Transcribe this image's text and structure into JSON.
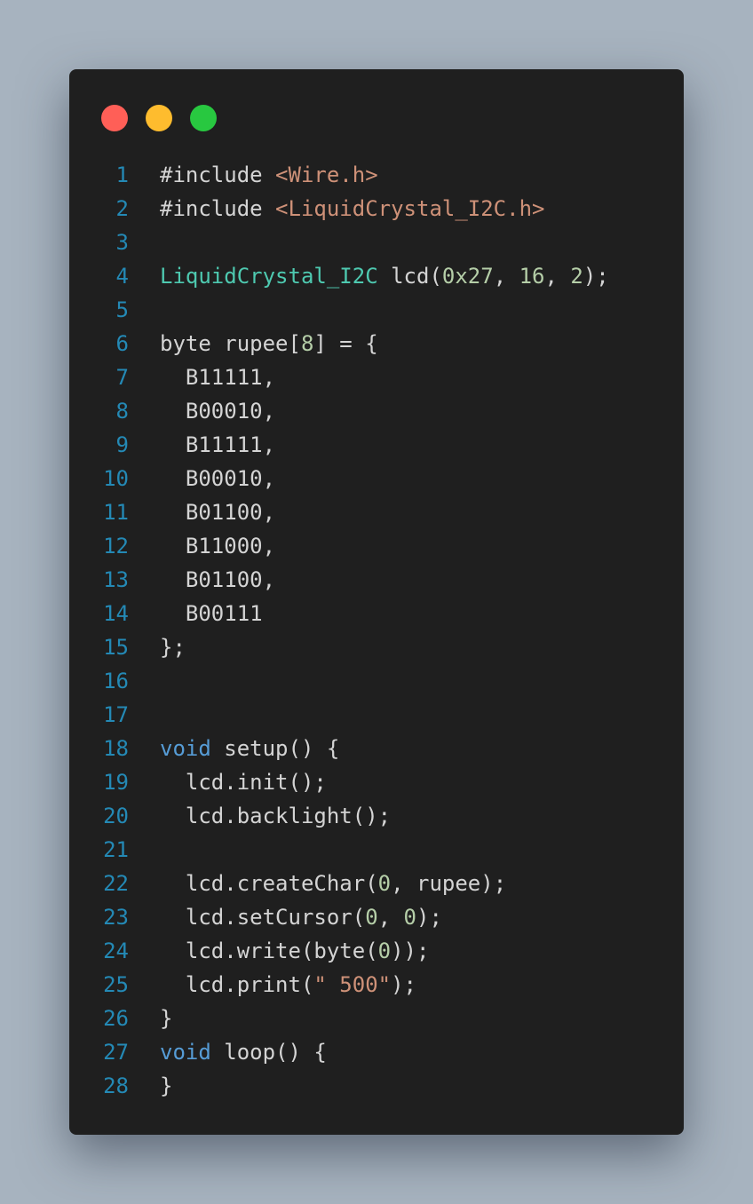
{
  "window": {
    "traffic_lights": [
      {
        "name": "close",
        "color": "#ff5f57"
      },
      {
        "name": "minimize",
        "color": "#febc2e"
      },
      {
        "name": "maximize",
        "color": "#28c840"
      }
    ]
  },
  "code": {
    "language": "cpp",
    "lines": [
      {
        "n": "1",
        "tokens": [
          {
            "t": "#include ",
            "c": "plain"
          },
          {
            "t": "<Wire.h>",
            "c": "str"
          }
        ]
      },
      {
        "n": "2",
        "tokens": [
          {
            "t": "#include ",
            "c": "plain"
          },
          {
            "t": "<LiquidCrystal_I2C.h>",
            "c": "str"
          }
        ]
      },
      {
        "n": "3",
        "tokens": []
      },
      {
        "n": "4",
        "tokens": [
          {
            "t": "LiquidCrystal_I2C",
            "c": "type"
          },
          {
            "t": " lcd(",
            "c": "plain"
          },
          {
            "t": "0x27",
            "c": "num"
          },
          {
            "t": ", ",
            "c": "plain"
          },
          {
            "t": "16",
            "c": "num"
          },
          {
            "t": ", ",
            "c": "plain"
          },
          {
            "t": "2",
            "c": "num"
          },
          {
            "t": ");",
            "c": "plain"
          }
        ]
      },
      {
        "n": "5",
        "tokens": []
      },
      {
        "n": "6",
        "tokens": [
          {
            "t": "byte rupee[",
            "c": "plain"
          },
          {
            "t": "8",
            "c": "num"
          },
          {
            "t": "] = {",
            "c": "plain"
          }
        ]
      },
      {
        "n": "7",
        "tokens": [
          {
            "t": "  B11111,",
            "c": "plain"
          }
        ]
      },
      {
        "n": "8",
        "tokens": [
          {
            "t": "  B00010,",
            "c": "plain"
          }
        ]
      },
      {
        "n": "9",
        "tokens": [
          {
            "t": "  B11111,",
            "c": "plain"
          }
        ]
      },
      {
        "n": "10",
        "tokens": [
          {
            "t": "  B00010,",
            "c": "plain"
          }
        ]
      },
      {
        "n": "11",
        "tokens": [
          {
            "t": "  B01100,",
            "c": "plain"
          }
        ]
      },
      {
        "n": "12",
        "tokens": [
          {
            "t": "  B11000,",
            "c": "plain"
          }
        ]
      },
      {
        "n": "13",
        "tokens": [
          {
            "t": "  B01100,",
            "c": "plain"
          }
        ]
      },
      {
        "n": "14",
        "tokens": [
          {
            "t": "  B00111",
            "c": "plain"
          }
        ]
      },
      {
        "n": "15",
        "tokens": [
          {
            "t": "};",
            "c": "plain"
          }
        ]
      },
      {
        "n": "16",
        "tokens": []
      },
      {
        "n": "17",
        "tokens": []
      },
      {
        "n": "18",
        "tokens": [
          {
            "t": "void",
            "c": "kw"
          },
          {
            "t": " setup() {",
            "c": "plain"
          }
        ]
      },
      {
        "n": "19",
        "tokens": [
          {
            "t": "  lcd.init();",
            "c": "plain"
          }
        ]
      },
      {
        "n": "20",
        "tokens": [
          {
            "t": "  lcd.backlight();",
            "c": "plain"
          }
        ]
      },
      {
        "n": "21",
        "tokens": []
      },
      {
        "n": "22",
        "tokens": [
          {
            "t": "  lcd.createChar(",
            "c": "plain"
          },
          {
            "t": "0",
            "c": "num"
          },
          {
            "t": ", rupee);",
            "c": "plain"
          }
        ]
      },
      {
        "n": "23",
        "tokens": [
          {
            "t": "  lcd.setCursor(",
            "c": "plain"
          },
          {
            "t": "0",
            "c": "num"
          },
          {
            "t": ", ",
            "c": "plain"
          },
          {
            "t": "0",
            "c": "num"
          },
          {
            "t": ");",
            "c": "plain"
          }
        ]
      },
      {
        "n": "24",
        "tokens": [
          {
            "t": "  lcd.write(byte(",
            "c": "plain"
          },
          {
            "t": "0",
            "c": "num"
          },
          {
            "t": "));",
            "c": "plain"
          }
        ]
      },
      {
        "n": "25",
        "tokens": [
          {
            "t": "  lcd.print(",
            "c": "plain"
          },
          {
            "t": "\" 500\"",
            "c": "str"
          },
          {
            "t": ");",
            "c": "plain"
          }
        ]
      },
      {
        "n": "26",
        "tokens": [
          {
            "t": "}",
            "c": "plain"
          }
        ]
      },
      {
        "n": "27",
        "tokens": [
          {
            "t": "void",
            "c": "kw"
          },
          {
            "t": " loop() {",
            "c": "plain"
          }
        ]
      },
      {
        "n": "28",
        "tokens": [
          {
            "t": "}",
            "c": "plain"
          }
        ]
      }
    ]
  }
}
